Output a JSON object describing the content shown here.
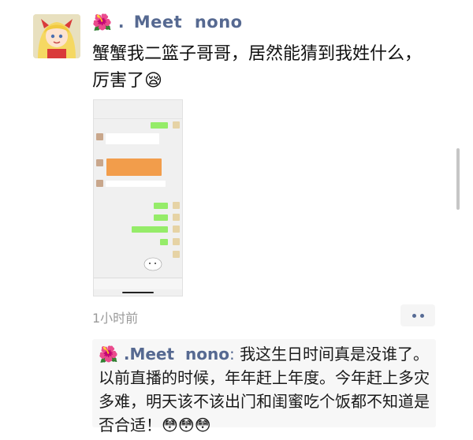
{
  "post": {
    "username": "Meet  nono",
    "username_prefix": "🌺 .",
    "text": "蟹蟹我二篮子哥哥，居然能猜到我姓什么，厉害了😪",
    "time": "1小时前"
  },
  "comment": {
    "name_prefix": "🌺 .",
    "name": "Meet  nono",
    "separator": ": ",
    "text": "我这生日时间真是没谁了。以前直播的时候，年年赶上年度。今年赶上多灾多难，明天该不该出门和闺蜜吃个饭都不知道是否合适！😳😳😳"
  },
  "colors": {
    "name_blue": "#566991",
    "chat_green": "#95ec69",
    "orange_card": "#f29d4b"
  },
  "icons": {
    "more": "more-dots-icon"
  }
}
